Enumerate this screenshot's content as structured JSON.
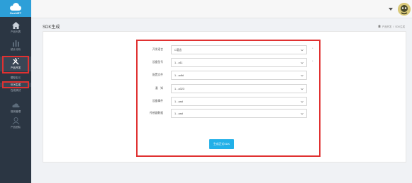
{
  "app": {
    "logo_text": "OneNET"
  },
  "sidebar": {
    "items": [
      {
        "label": "产品列表",
        "icon": "home-icon"
      },
      {
        "label": "统计分析",
        "icon": "bar-chart-icon"
      },
      {
        "label": "产品开发",
        "icon": "tools-icon"
      },
      {
        "label": "规则管理",
        "icon": "cloud-icon"
      },
      {
        "label": "产品团队",
        "icon": "team-icon"
      }
    ],
    "sub_items": [
      {
        "label": "模型定义"
      },
      {
        "label": "SDK生成"
      },
      {
        "label": "在线调试"
      }
    ]
  },
  "header": {
    "page_title": "SDK生成"
  },
  "breadcrumb": {
    "parent": "产品开发",
    "sep": "/",
    "current": "SDK生成"
  },
  "form": {
    "fields": [
      {
        "label": "开发语言",
        "value": "C语言",
        "required": "*"
      },
      {
        "label": "设备型号",
        "value": "1 - a11",
        "required": "*"
      },
      {
        "label": "配置文件",
        "value": "1 - adfd",
        "required": ""
      },
      {
        "label": "通　知",
        "value": "1 - a323",
        "required": ""
      },
      {
        "label": "设备事件",
        "value": "1 - aad",
        "required": ""
      },
      {
        "label": "传感器数据",
        "value": "1 - aad",
        "required": ""
      }
    ],
    "submit_label": "生成正式SDK"
  },
  "colors": {
    "accent": "#22b0e8",
    "sidebar_bg": "#2b3643",
    "highlight": "#e03131"
  }
}
